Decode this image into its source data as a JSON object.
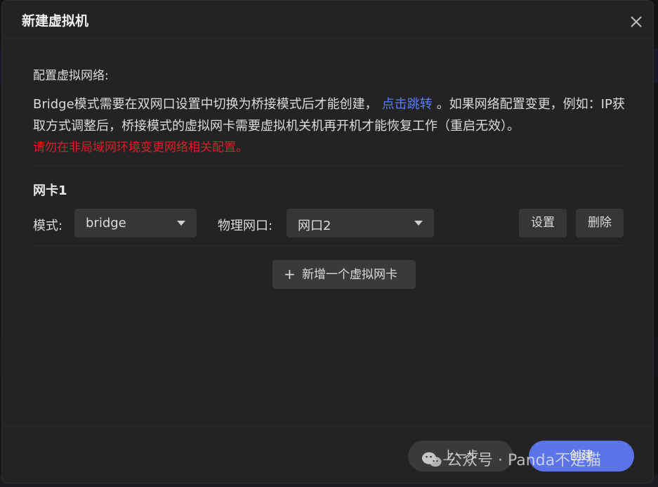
{
  "dialog": {
    "title": "新建虚拟机",
    "close_icon": "close-icon"
  },
  "network": {
    "section_label": "配置虚拟网络:",
    "description_before_link": "Bridge模式需要在双网口设置中切换为桥接模式后才能创建，",
    "link_text": "点击跳转",
    "description_after_link": "。如果网络配置变更，例如：IP获取方式调整后，桥接模式的虚拟网卡需要虚拟机关机再开机才能恢复工作（重启无效）。",
    "warning": "请勿在非局域网环境变更网络相关配置。",
    "warning_color": "#d6212b",
    "link_color": "#5c7cfa"
  },
  "nic": {
    "title": "网卡1",
    "mode_label": "模式:",
    "mode_value": "bridge",
    "port_label": "物理网口:",
    "port_value": "网口2",
    "settings_button": "设置",
    "delete_button": "删除"
  },
  "add_nic": {
    "label": "新增一个虚拟网卡",
    "icon": "plus-icon"
  },
  "footer": {
    "prev_button": "上一步",
    "create_button": "创建",
    "accent_color": "#5b74e8"
  },
  "watermark": {
    "text": "公众号 · Panda不是猫"
  }
}
